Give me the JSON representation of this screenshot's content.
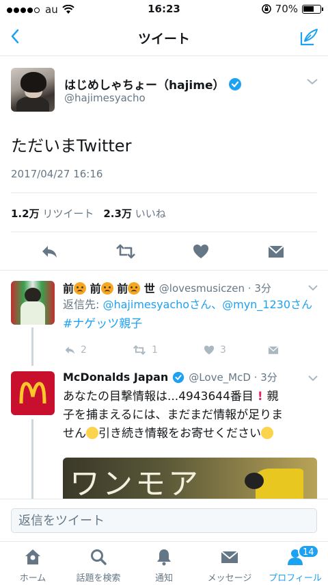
{
  "status_bar": {
    "carrier": "au",
    "time": "16:23",
    "battery": "70%",
    "signal_bars": 4,
    "signal_total": 5,
    "battery_level": 0.7
  },
  "nav": {
    "title": "ツイート"
  },
  "main_tweet": {
    "name": "はじめしゃちょー（hajime）",
    "handle": "@hajimesyacho",
    "text": "ただいまTwitter",
    "date": "2017/04/27 16:16",
    "retweets_count": "1.2万",
    "retweets_label": "リツイート",
    "likes_count": "2.3万",
    "likes_label": "いいね"
  },
  "replies": [
    {
      "name_parts": [
        "前",
        "前",
        "前",
        "世"
      ],
      "handle_time": "@lovesmusiczen · 3分",
      "reply_to_label": "返信先: ",
      "reply_to_user1": "@hajimesyacho",
      "reply_to_suffix1": "さん、",
      "reply_to_user2": "@myn_1230",
      "reply_to_suffix2": "さん",
      "hashtag": "#ナゲッツ親子",
      "reply_count": "2",
      "retweet_count": "1",
      "like_count": "3"
    },
    {
      "name": "McDonalds Japan",
      "handle_time": "@Love_McD · 3分",
      "text_line1": "あなたの目撃情報は...4943644番目",
      "text_line1b": "親",
      "text_line2": "子を捕まえるには、まだまだ情報が足りま",
      "text_line3": "せん",
      "text_line3b": "引き続き情報をお寄せください",
      "media_text": "ワンモア"
    }
  ],
  "reply_bar": {
    "placeholder": "返信をツイート"
  },
  "tabs": [
    {
      "label": "ホーム",
      "icon": "home-icon"
    },
    {
      "label": "話題を検索",
      "icon": "search-icon"
    },
    {
      "label": "通知",
      "icon": "bell-icon"
    },
    {
      "label": "メッセージ",
      "icon": "envelope-icon"
    },
    {
      "label": "プロフィール",
      "icon": "profile-icon",
      "badge": "14"
    }
  ],
  "colors": {
    "accent": "#1da1f2",
    "text": "#14171a",
    "muted": "#657786",
    "mcd_red": "#c8102e",
    "mcd_yellow": "#ffc72c"
  }
}
